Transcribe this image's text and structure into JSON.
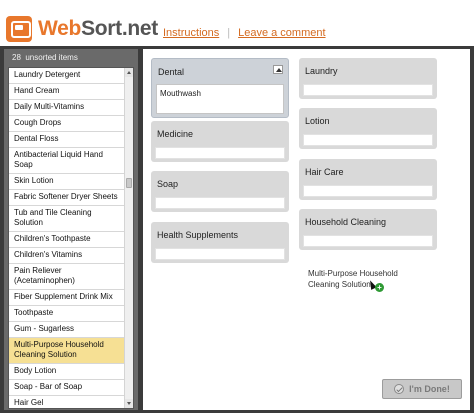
{
  "header": {
    "logo_prefix": "Web",
    "logo_suffix": "Sort.net",
    "nav": [
      "Instructions",
      "Leave a comment"
    ],
    "separator": "|"
  },
  "sidebar": {
    "count": "28",
    "count_label": "unsorted items",
    "items": [
      "Laundry Detergent",
      "Hand Cream",
      "Daily Multi-Vitamins",
      "Cough Drops",
      "Dental Floss",
      "Antibacterial Liquid Hand Soap",
      "Skin Lotion",
      "Fabric Softener Dryer Sheets",
      "Tub and Tile Cleaning Solution",
      "Children's Toothpaste",
      "Children's Vitamins",
      "Pain Reliever (Acetaminophen)",
      "Fiber Supplement Drink Mix",
      "Toothpaste",
      "Gum - Sugarless",
      "Multi-Purpose Household Cleaning Solution",
      "Body Lotion",
      "Soap - Bar of Soap",
      "Hair Gel"
    ],
    "selected_item": "Multi-Purpose Household Cleaning Solution"
  },
  "categories": {
    "left": [
      {
        "name": "Dental",
        "items": [
          "Mouthwash"
        ]
      },
      {
        "name": "Medicine",
        "items": []
      },
      {
        "name": "Soap",
        "items": []
      },
      {
        "name": "Health Supplements",
        "items": []
      }
    ],
    "right": [
      {
        "name": "Laundry",
        "items": []
      },
      {
        "name": "Lotion",
        "items": []
      },
      {
        "name": "Hair Care",
        "items": []
      },
      {
        "name": "Household Cleaning",
        "items": []
      }
    ]
  },
  "drag": {
    "label_line1": "Multi-Purpose Household",
    "label_line2": "Cleaning Solution",
    "badge": "+"
  },
  "footer": {
    "done_label": "I'm Done!"
  },
  "colors": {
    "brand_orange": "#e8772c",
    "frame_dark": "#3b3b3b",
    "selected_yellow": "#f6e094",
    "drop_green": "#2f9a35"
  }
}
